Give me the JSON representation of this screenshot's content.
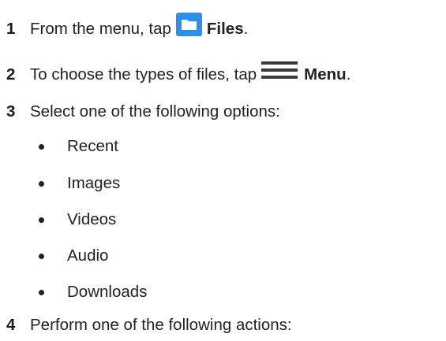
{
  "steps": [
    {
      "number": "1",
      "before": "From the menu, tap",
      "icon": "folder-icon",
      "term": "Files",
      "after": "."
    },
    {
      "number": "2",
      "before": "To choose the types of files, tap",
      "icon": "hamburger-menu-icon",
      "term": "Menu",
      "after": "."
    },
    {
      "number": "3",
      "text": "Select one of the following options:"
    },
    {
      "number": "4",
      "text": "Perform one of the following actions:"
    }
  ],
  "options": [
    "Recent",
    "Images",
    "Videos",
    "Audio",
    "Downloads"
  ],
  "colors": {
    "folder_icon": "#2f8fe8",
    "menu_icon": "#3a3a3a",
    "text": "#222222"
  }
}
